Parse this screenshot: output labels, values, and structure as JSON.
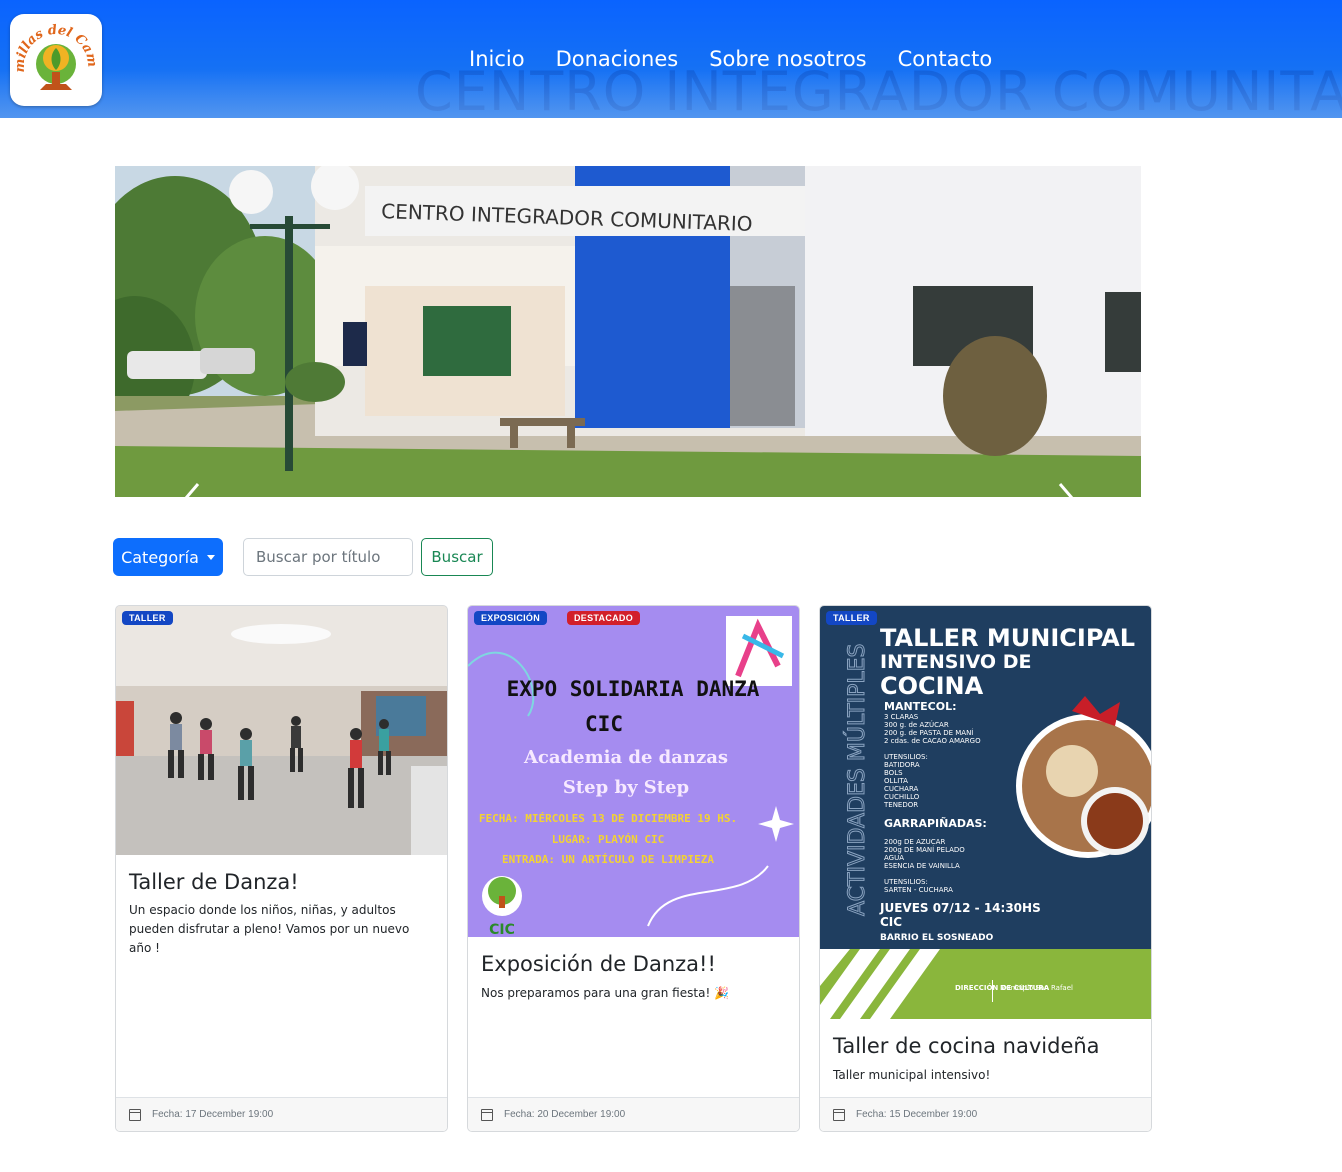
{
  "nav": {
    "watermark": "CENTRO INTEGRADOR COMUNITARIO",
    "logo_text": "Semillas del Cambio",
    "links": [
      "Inicio",
      "Donaciones",
      "Sobre nosotros",
      "Contacto"
    ]
  },
  "carousel": {
    "sign_text": "CENTRO INTEGRADOR COMUNITARIO",
    "prev_icon": "chevron-left-icon",
    "next_icon": "chevron-right-icon"
  },
  "filters": {
    "category_label": "Categoría",
    "search_placeholder": "Buscar por título",
    "search_button": "Buscar"
  },
  "cards": [
    {
      "badges": [
        "TALLER"
      ],
      "title": "Taller de Danza!",
      "text": "Un espacio donde los niños, niñas, y adultos pueden disfrutar a pleno! Vamos por un nuevo año !",
      "date": "Fecha: 17 December 19:00"
    },
    {
      "badges": [
        "EXPOSICIÓN",
        "DESTACADO"
      ],
      "title": "Exposición de Danza!!",
      "text": "Nos preparamos para una gran fiesta! 🎉",
      "date": "Fecha: 20 December 19:00",
      "poster": {
        "line1": "EXPO SOLIDARIA DANZA",
        "line2": "CIC",
        "line3": "Academia de danzas",
        "line4": "Step by Step",
        "line5": "FECHA: MIÉRCOLES 13 DE DICIEMBRE 19 HS.",
        "line6": "LUGAR: PLAYÓN CIC",
        "line7": "ENTRADA: UN ARTÍCULO DE LIMPIEZA",
        "logo": "CIC"
      }
    },
    {
      "badges": [
        "TALLER"
      ],
      "title": "Taller de cocina navideña",
      "text": "Taller municipal intensivo!",
      "date": "Fecha: 15 December 19:00",
      "poster": {
        "side": "ACTIVIDADES MÚLTIPLES",
        "h1": "TALLER MUNICIPAL",
        "h2": "INTENSIVO DE",
        "h3": "COCINA",
        "s1": "MANTECOL:",
        "s1_items": [
          "3 CLARAS",
          "300 g. de AZÚCAR",
          "200 g. de PASTA DE MANÍ",
          "2 cdas. de CACAO AMARGO"
        ],
        "u1": "UTENSILIOS:",
        "u1_items": [
          "BATIDORA",
          "BOLS",
          "OLLITA",
          "CUCHARA",
          "CUCHILLO",
          "TENEDOR"
        ],
        "s2": "GARRAPIÑADAS:",
        "s2_items": [
          "200g DE AZUCAR",
          "200g DE MANÍ PELADO",
          "AGUA",
          "ESENCIA DE VAINILLA"
        ],
        "u2": "UTENSILIOS:",
        "u2_items": [
          "SARTEN - CUCHARA"
        ],
        "when": "JUEVES 07/12 - 14:30HS",
        "where": "CIC",
        "place": "BARRIO EL SOSNEADO",
        "org1": "DIRECCIÓN DE CULTURA",
        "org2": "Municipio San Rafael"
      }
    }
  ]
}
